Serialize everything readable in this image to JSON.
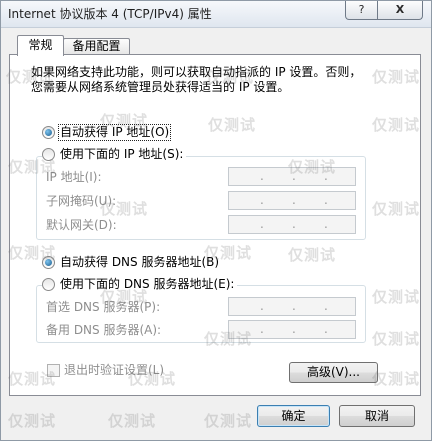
{
  "window": {
    "title": "Internet 协议版本 4 (TCP/IPv4) 属性",
    "help_icon": "?",
    "close_icon": "X"
  },
  "tabs": [
    {
      "label": "常规",
      "selected": true
    },
    {
      "label": "备用配置",
      "selected": false
    }
  ],
  "general": {
    "intro": [
      "如果网络支持此功能，则可以获取自动指派的 IP 设置。否则，",
      "您需要从网络系统管理员处获得适当的 IP 设置。"
    ],
    "ip_radios": [
      {
        "label": "自动获得 IP 地址(O)",
        "checked": true,
        "focused": true
      },
      {
        "label": "使用下面的 IP 地址(S):",
        "checked": false,
        "focused": false
      }
    ],
    "ip_fields": [
      {
        "label": "IP 地址(I):",
        "enabled": false
      },
      {
        "label": "子网掩码(U):",
        "enabled": false
      },
      {
        "label": "默认网关(D):",
        "enabled": false
      }
    ],
    "octet_separator": ".",
    "dns_radios": [
      {
        "label": "自动获得 DNS 服务器地址(B)",
        "checked": true
      },
      {
        "label": "使用下面的 DNS 服务器地址(E):",
        "checked": false
      }
    ],
    "dns_fields": [
      {
        "label": "首选 DNS 服务器(P):",
        "enabled": false
      },
      {
        "label": "备用 DNS 服务器(A):",
        "enabled": false
      }
    ],
    "validate_on_exit": {
      "label": "退出时验证设置(L)",
      "checked": false,
      "enabled": false
    },
    "advanced_button": "高级(V)..."
  },
  "footer": {
    "ok_button": "确定",
    "cancel_button": "取消"
  },
  "watermark": {
    "text": "仅测试"
  },
  "colors": {
    "dialog": "#f0f0f0",
    "title_bar": "#dfe6ef",
    "panel": "#ffffff",
    "disabled_text": "#8e8e8e",
    "default_button_border": "#3c7fb1",
    "radio_dot": "#1d5e8e"
  }
}
